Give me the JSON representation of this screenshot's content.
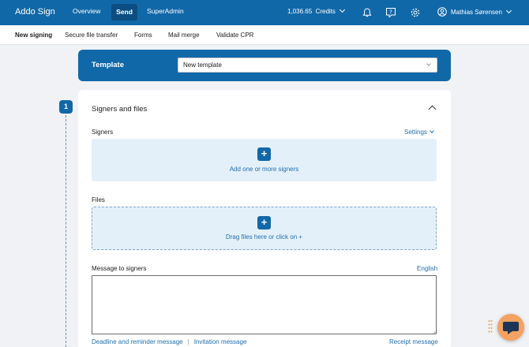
{
  "app": {
    "title": "Addo Sign"
  },
  "nav": {
    "overview": "Overview",
    "send": "Send",
    "superadmin": "SuperAdmin"
  },
  "credits": {
    "amount": "1,036.65",
    "label": "Credits"
  },
  "user": {
    "name": "Mathias Sørensen"
  },
  "icons": {
    "bell": "bell-icon",
    "help": "help-icon",
    "settings": "gear-icon",
    "user": "user-circle-icon"
  },
  "subnav": {
    "new_signing": "New signing",
    "secure_file_transfer": "Secure file transfer",
    "forms": "Forms",
    "mail_merge": "Mail merge",
    "validate_cpr": "Validate CPR"
  },
  "template": {
    "label": "Template",
    "selected": "New template"
  },
  "step": {
    "number": "1",
    "title": "Signers and files"
  },
  "signers": {
    "label": "Signers",
    "settings_link": "Settings",
    "add_text": "Add one or more signers"
  },
  "files": {
    "label": "Files",
    "drop_text": "Drag files here or click on +"
  },
  "message": {
    "label": "Message to signers",
    "language": "English",
    "value": ""
  },
  "footer_links": {
    "deadline": "Deadline and reminder message",
    "separator": "|",
    "invitation": "Invitation message",
    "receipt": "Receipt message"
  },
  "colors": {
    "primary": "#1168a8",
    "light_blue": "#e4f0f9",
    "link": "#1f6fb0",
    "chat": "#f4a261"
  }
}
